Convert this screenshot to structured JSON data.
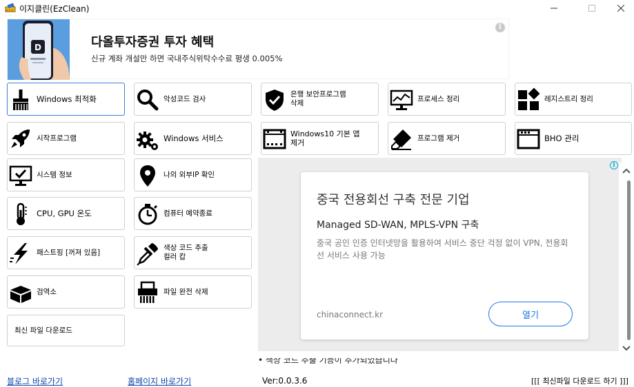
{
  "window": {
    "title": "이지클린(EzClean)",
    "icon": "broom-app-icon",
    "controls": [
      "minimize",
      "maximize",
      "close"
    ]
  },
  "banner_ad": {
    "title": "다올투자증권 투자 혜택",
    "subtitle": "신규 계좌 개설만 하면 국내주식위탁수수료 평생 0.005%",
    "info_icon": "i"
  },
  "tools": {
    "windows_optimize": {
      "label": "Windows 최적화",
      "icon": "broom-icon"
    },
    "malware_scan": {
      "label": "악성코드 검사",
      "icon": "magnifier-icon"
    },
    "bank_security_remove": {
      "label": "은행 보안프로그램\n삭제",
      "icon": "shield-check-icon"
    },
    "process_cleanup": {
      "label": "프로세스 정리",
      "icon": "monitor-chart-icon"
    },
    "registry_cleanup": {
      "label": "레지스트리 정리",
      "icon": "blocks-icon"
    },
    "startup_programs": {
      "label": "시작프로그램",
      "icon": "rocket-icon"
    },
    "windows_services": {
      "label": "Windows 서비스",
      "icon": "gears-icon"
    },
    "win10_default_apps": {
      "label": "Windows10 기본 앱\n제거",
      "icon": "film-window-icon"
    },
    "program_remove": {
      "label": "프로그램 제거",
      "icon": "eraser-icon"
    },
    "bho_manage": {
      "label": "BHO 관리",
      "icon": "browser-window-icon"
    },
    "system_info": {
      "label": "시스템 정보",
      "icon": "monitor-check-icon"
    },
    "external_ip": {
      "label": "나의 외부IP 확인",
      "icon": "map-pin-icon"
    },
    "cpu_gpu_temp": {
      "label": "CPU, GPU 온도",
      "icon": "thermometer-icon"
    },
    "scheduled_shutdown": {
      "label": "컴퓨터 예약종료",
      "icon": "stopwatch-icon"
    },
    "fast_ping": {
      "label": "패스트핑 [꺼져 있음]",
      "icon": "lightning-icon"
    },
    "color_picker": {
      "label": "색상 코드 추출\n컬러 캅",
      "icon": "eyedropper-icon"
    },
    "quarantine": {
      "label": "검역소",
      "icon": "box-icon"
    },
    "secure_delete": {
      "label": "파일 완전 삭제",
      "icon": "shredder-icon"
    },
    "latest_download": {
      "label": "최신 파일 다운로드"
    }
  },
  "display_ad": {
    "title": "중국 전용회선 구축 전문 기업",
    "subtitle": "Managed SD-WAN, MPLS-VPN 구축",
    "description": "중국 공인 인증 인터넷망을 활용하여 서비스 중단 걱정 없이 VPN, 전용회선 서비스 사용 가능",
    "domain": "chinaconnect.kr",
    "cta": "열기",
    "info_icon": "i"
  },
  "notice_clipped": "• 색상 코드 추출 기능이 추가되었습니다",
  "footer": {
    "blog_link": "블로그 바로가기",
    "homepage_link": "홈페이지 바로가기",
    "version": "Ver:0.0.3.6",
    "latest_download": "[[[ 최신파일 다운로드 하기 ]]]"
  },
  "colors": {
    "active_border": "#3a7ee0",
    "link": "#0645ad",
    "ad_button": "#1a73e8",
    "ad_background": "#ececec"
  }
}
